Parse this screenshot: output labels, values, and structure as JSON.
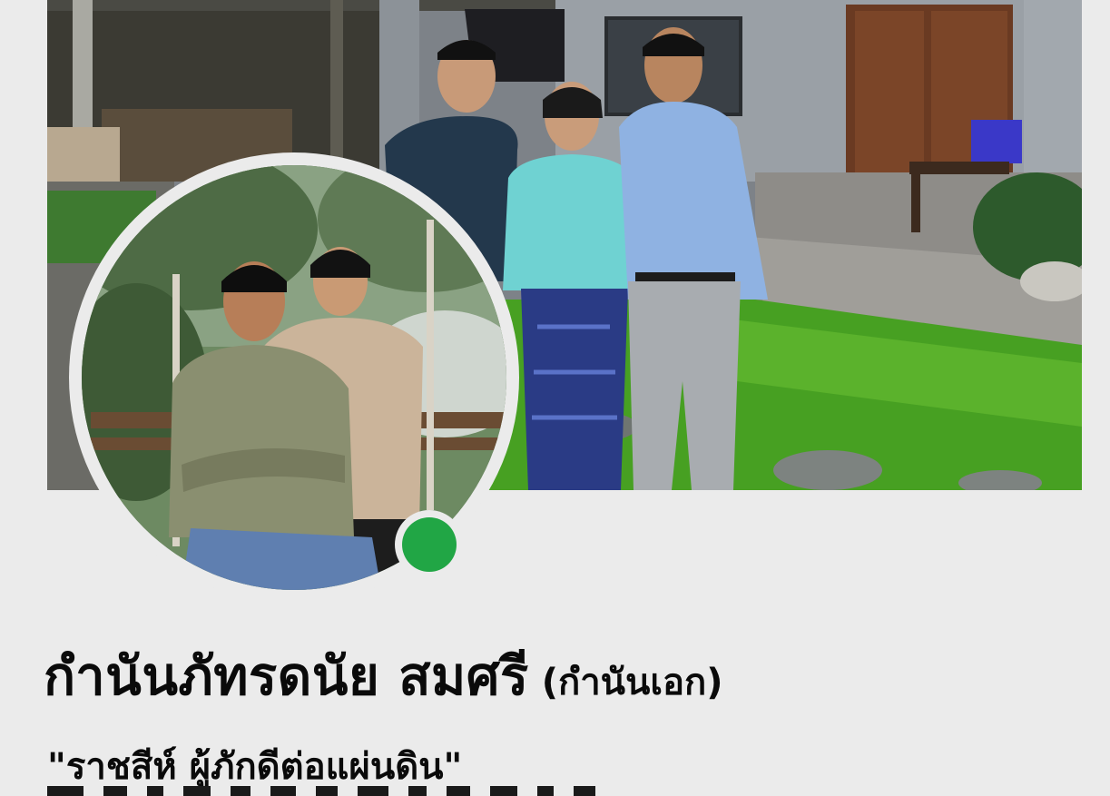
{
  "profile": {
    "name": "กำนันภัทรดนัย สมศรี",
    "nickname": "(กำนันเอก)",
    "bio": "\"ราชสีห์ ผู้ภักดีต่อแผ่นดิน\""
  },
  "status": {
    "online": true,
    "color": "#21a645"
  },
  "colors": {
    "page_background": "#ebebeb",
    "text": "#0a0a0a"
  }
}
